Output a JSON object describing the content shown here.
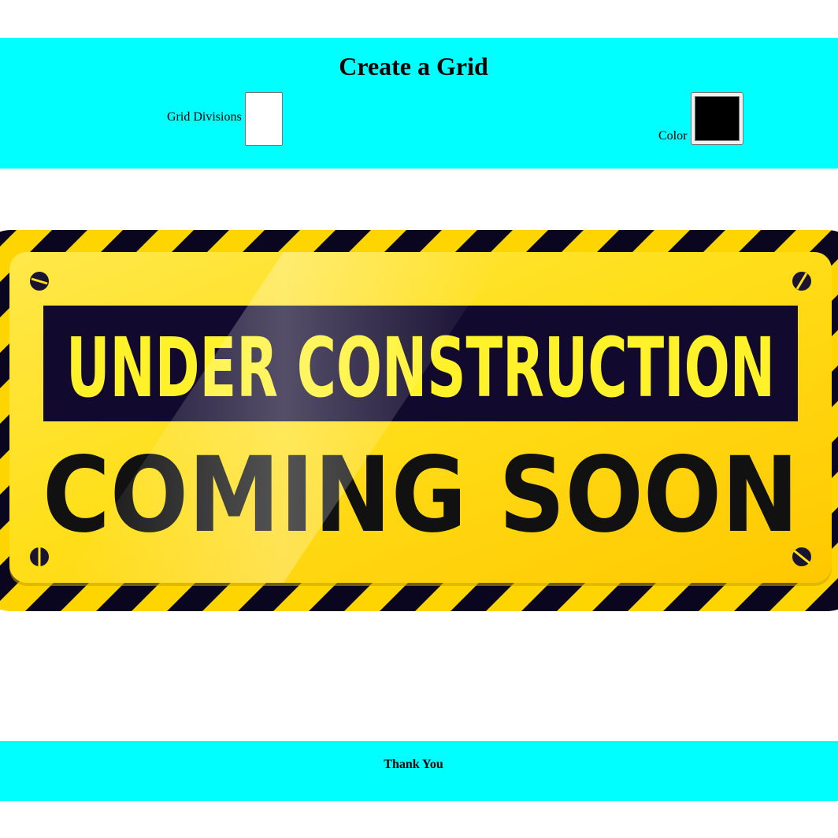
{
  "header": {
    "title": "Create a Grid",
    "grid_divisions_label": "Grid Divisions",
    "grid_divisions_value": "",
    "color_label": "Color",
    "color_value": "#000000",
    "background_color": "#00ffff"
  },
  "sign": {
    "line1": "UNDER CONSTRUCTION",
    "line2": "COMING SOON",
    "colors": {
      "stripe_dark": "#0b0620",
      "stripe_yellow": "#ffd500",
      "plate_yellow": "#ffe11a",
      "banner_dark": "#120a2e",
      "banner_text": "#fff22a",
      "main_text": "#111111"
    }
  },
  "footer": {
    "text": "Thank You"
  }
}
